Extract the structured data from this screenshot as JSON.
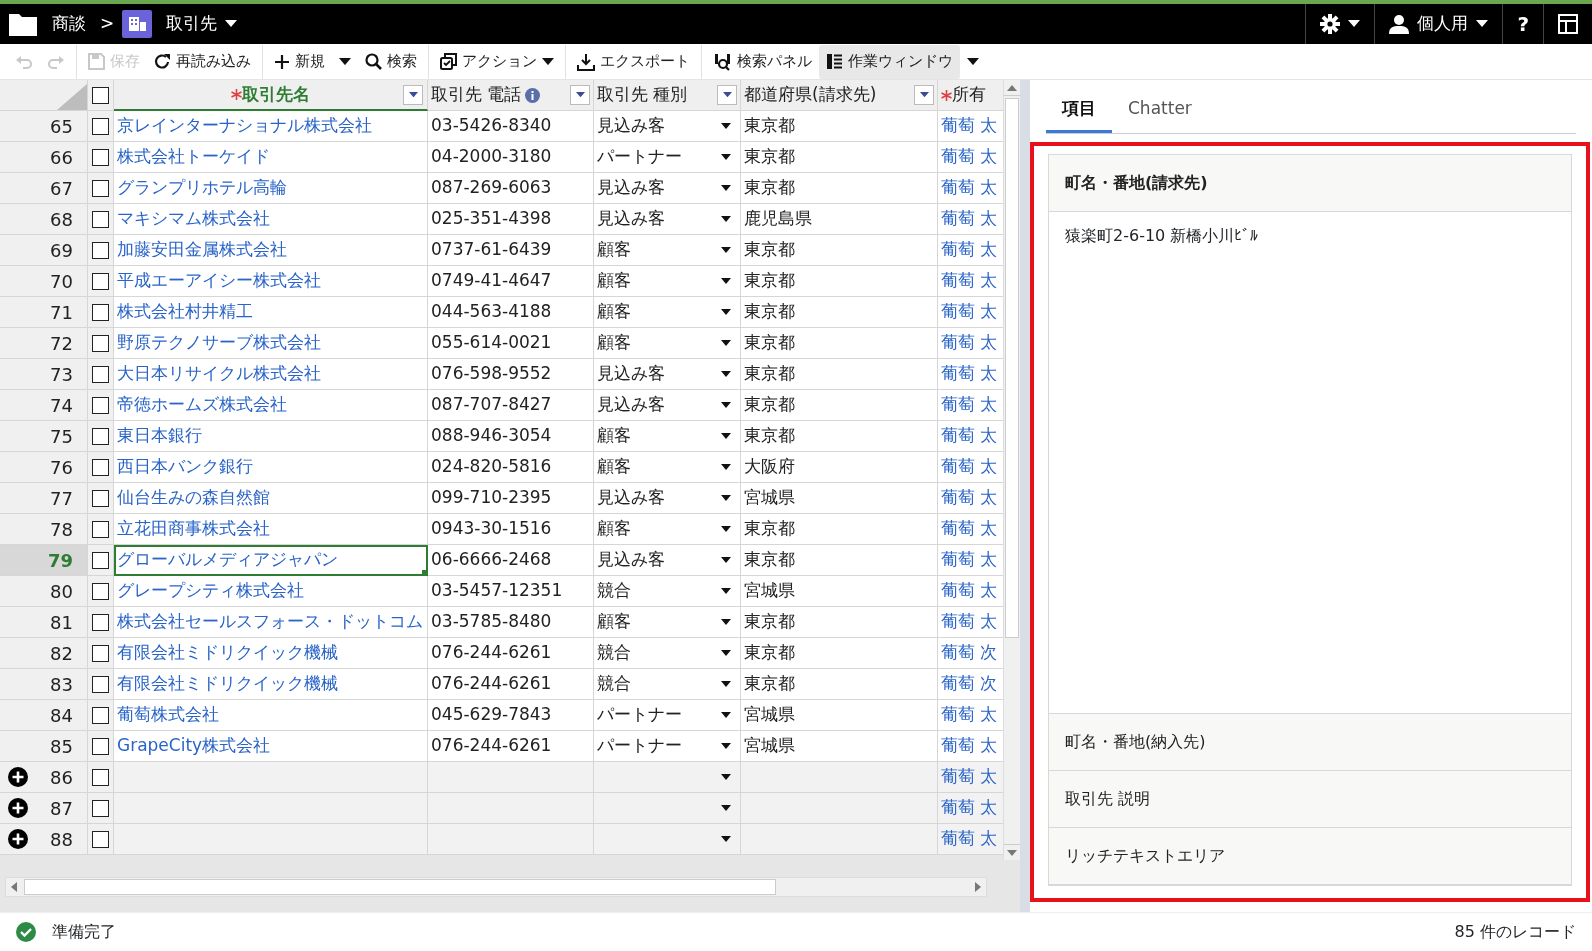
{
  "topbar": {
    "breadcrumb": [
      {
        "label": "商談",
        "menu": false
      },
      {
        "label": "取引先",
        "menu": true
      }
    ],
    "separator": ">",
    "settings_menu": true,
    "user": {
      "label": "個人用",
      "menu": true
    },
    "help": "?"
  },
  "toolbar": [
    {
      "items": [
        {
          "kind": "undo",
          "disabled": true,
          "selected": false
        },
        {
          "kind": "redo",
          "disabled": true,
          "selected": false
        }
      ]
    },
    {
      "items": [
        {
          "kind": "save",
          "label": "保存",
          "disabled": true,
          "selected": false
        },
        {
          "kind": "reload",
          "label": "再読み込み",
          "disabled": false,
          "selected": false
        }
      ]
    },
    {
      "items": [
        {
          "kind": "new",
          "label": "新規",
          "disabled": false,
          "selected": false
        },
        {
          "kind": "dropdown",
          "disabled": false,
          "selected": false
        },
        {
          "kind": "search",
          "label": "検索",
          "disabled": false,
          "selected": false
        }
      ]
    },
    {
      "items": [
        {
          "kind": "action",
          "label": "アクション",
          "disabled": false,
          "selected": false
        }
      ]
    },
    {
      "items": [
        {
          "kind": "export",
          "label": "エクスポート",
          "disabled": false,
          "selected": false
        }
      ]
    },
    {
      "items": [
        {
          "kind": "search_panel",
          "label": "検索パネル",
          "disabled": false,
          "selected": false
        },
        {
          "kind": "work_window",
          "label": "作業ウィンドウ",
          "disabled": false,
          "selected": true
        },
        {
          "kind": "dropdown",
          "disabled": false,
          "selected": false
        }
      ]
    }
  ],
  "grid": {
    "all_checked": false,
    "columns": [
      {
        "label": "取引先名",
        "required": true,
        "active": true,
        "info": false,
        "filter": true
      },
      {
        "label": "取引先 電話",
        "required": false,
        "active": false,
        "info": true,
        "filter": true
      },
      {
        "label": "取引先 種別",
        "required": false,
        "active": false,
        "info": false,
        "filter": true
      },
      {
        "label": "都道府県(請求先)",
        "required": false,
        "active": false,
        "info": false,
        "filter": true
      },
      {
        "label": "所有",
        "required": true,
        "active": false,
        "info": false,
        "filter": false
      }
    ],
    "rows": [
      {
        "kind": "record",
        "num": "65",
        "checked": false,
        "selected": false,
        "name": "京レインターナショナル株式会社",
        "phone": "03-5426-8340",
        "type": "見込み客",
        "prefecture": "東京都",
        "owner": "葡萄 太"
      },
      {
        "kind": "record",
        "num": "66",
        "checked": false,
        "selected": false,
        "name": "株式会社トーケイド",
        "phone": "04-2000-3180",
        "type": "パートナー",
        "prefecture": "東京都",
        "owner": "葡萄 太"
      },
      {
        "kind": "record",
        "num": "67",
        "checked": false,
        "selected": false,
        "name": "グランプリホテル高輪",
        "phone": "087-269-6063",
        "type": "見込み客",
        "prefecture": "東京都",
        "owner": "葡萄 太"
      },
      {
        "kind": "record",
        "num": "68",
        "checked": false,
        "selected": false,
        "name": "マキシマム株式会社",
        "phone": "025-351-4398",
        "type": "見込み客",
        "prefecture": "鹿児島県",
        "owner": "葡萄 太"
      },
      {
        "kind": "record",
        "num": "69",
        "checked": false,
        "selected": false,
        "name": "加藤安田金属株式会社",
        "phone": "0737-61-6439",
        "type": "顧客",
        "prefecture": "東京都",
        "owner": "葡萄 太"
      },
      {
        "kind": "record",
        "num": "70",
        "checked": false,
        "selected": false,
        "name": "平成エーアイシー株式会社",
        "phone": "0749-41-4647",
        "type": "顧客",
        "prefecture": "東京都",
        "owner": "葡萄 太"
      },
      {
        "kind": "record",
        "num": "71",
        "checked": false,
        "selected": false,
        "name": "株式会社村井精工",
        "phone": "044-563-4188",
        "type": "顧客",
        "prefecture": "東京都",
        "owner": "葡萄 太"
      },
      {
        "kind": "record",
        "num": "72",
        "checked": false,
        "selected": false,
        "name": "野原テクノサーブ株式会社",
        "phone": "055-614-0021",
        "type": "顧客",
        "prefecture": "東京都",
        "owner": "葡萄 太"
      },
      {
        "kind": "record",
        "num": "73",
        "checked": false,
        "selected": false,
        "name": "大日本リサイクル株式会社",
        "phone": "076-598-9552",
        "type": "見込み客",
        "prefecture": "東京都",
        "owner": "葡萄 太"
      },
      {
        "kind": "record",
        "num": "74",
        "checked": false,
        "selected": false,
        "name": "帝徳ホームズ株式会社",
        "phone": "087-707-8427",
        "type": "見込み客",
        "prefecture": "東京都",
        "owner": "葡萄 太"
      },
      {
        "kind": "record",
        "num": "75",
        "checked": false,
        "selected": false,
        "name": "東日本銀行",
        "phone": "088-946-3054",
        "type": "顧客",
        "prefecture": "東京都",
        "owner": "葡萄 太"
      },
      {
        "kind": "record",
        "num": "76",
        "checked": false,
        "selected": false,
        "name": "西日本バンク銀行",
        "phone": "024-820-5816",
        "type": "顧客",
        "prefecture": "大阪府",
        "owner": "葡萄 太"
      },
      {
        "kind": "record",
        "num": "77",
        "checked": false,
        "selected": false,
        "name": "仙台生みの森自然館",
        "phone": "099-710-2395",
        "type": "見込み客",
        "prefecture": "宮城県",
        "owner": "葡萄 太"
      },
      {
        "kind": "record",
        "num": "78",
        "checked": false,
        "selected": false,
        "name": "立花田商事株式会社",
        "phone": "0943-30-1516",
        "type": "顧客",
        "prefecture": "東京都",
        "owner": "葡萄 太"
      },
      {
        "kind": "record",
        "num": "79",
        "checked": false,
        "selected": true,
        "name": "グローバルメディアジャパン",
        "phone": "06-6666-2468",
        "type": "見込み客",
        "prefecture": "東京都",
        "owner": "葡萄 太"
      },
      {
        "kind": "record",
        "num": "80",
        "checked": false,
        "selected": false,
        "name": "グレープシティ株式会社",
        "phone": "03-5457-12351",
        "type": "競合",
        "prefecture": "宮城県",
        "owner": "葡萄 太"
      },
      {
        "kind": "record",
        "num": "81",
        "checked": false,
        "selected": false,
        "name": "株式会社セールスフォース・ドットコム",
        "phone": "03-5785-8480",
        "type": "顧客",
        "prefecture": "東京都",
        "owner": "葡萄 太"
      },
      {
        "kind": "record",
        "num": "82",
        "checked": false,
        "selected": false,
        "name": "有限会社ミドリクイック機械",
        "phone": "076-244-6261",
        "type": "競合",
        "prefecture": "東京都",
        "owner": "葡萄 次"
      },
      {
        "kind": "record",
        "num": "83",
        "checked": false,
        "selected": false,
        "name": "有限会社ミドリクイック機械",
        "phone": "076-244-6261",
        "type": "競合",
        "prefecture": "東京都",
        "owner": "葡萄 次"
      },
      {
        "kind": "record",
        "num": "84",
        "checked": false,
        "selected": false,
        "name": "葡萄株式会社",
        "phone": "045-629-7843",
        "type": "パートナー",
        "prefecture": "宮城県",
        "owner": "葡萄 太"
      },
      {
        "kind": "record",
        "num": "85",
        "checked": false,
        "selected": false,
        "name": "GrapeCity株式会社",
        "phone": "076-244-6261",
        "type": "パートナー",
        "prefecture": "宮城県",
        "owner": "葡萄 太"
      },
      {
        "kind": "new",
        "num": "86",
        "checked": false,
        "selected": false,
        "owner": "葡萄 太"
      },
      {
        "kind": "new",
        "num": "87",
        "checked": false,
        "selected": false,
        "owner": "葡萄 太"
      },
      {
        "kind": "new",
        "num": "88",
        "checked": false,
        "selected": false,
        "owner": "葡萄 太"
      }
    ]
  },
  "side_panel": {
    "highlighted": true,
    "tabs": [
      {
        "label": "項目",
        "selected": true
      },
      {
        "label": "Chatter",
        "selected": false
      }
    ],
    "sections": [
      {
        "label": "町名・番地(請求先)",
        "expanded": true,
        "value": "猿楽町2-6-10 新橋小川ﾋﾞﾙ"
      },
      {
        "label": "町名・番地(納入先)",
        "expanded": false
      },
      {
        "label": "取引先 説明",
        "expanded": false
      },
      {
        "label": "リッチテキストエリア",
        "expanded": false
      }
    ]
  },
  "status_bar": {
    "text": "準備完了",
    "record_count": "85 件のレコード"
  }
}
